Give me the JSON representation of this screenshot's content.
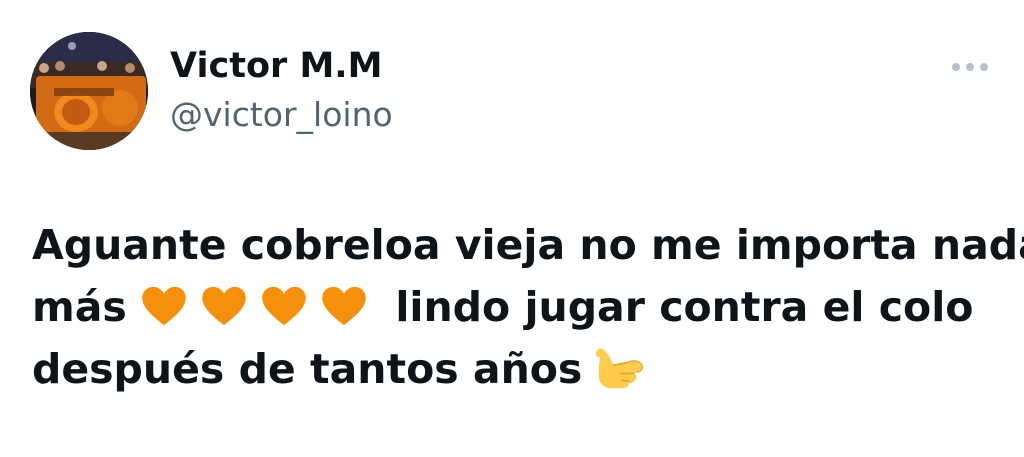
{
  "author": {
    "display_name": "Victor M.M",
    "handle": "@victor_loino",
    "avatar_icon": "avatar-photo"
  },
  "toolbar": {
    "more_icon": "more-horizontal-icon"
  },
  "tweet": {
    "line1": "Aguante cobreloa vieja no me importa nada",
    "line2_before": "más",
    "line2_after": "lindo jugar contra el colo",
    "line3": "después de tantos años",
    "emojis": [
      "orange-heart",
      "orange-heart",
      "orange-heart",
      "orange-heart",
      "call-me-hand"
    ]
  },
  "colors": {
    "text": "#0f1419",
    "handle": "#536471",
    "heart": "#f4900c",
    "hand": "#ffcc4d",
    "dots": "#b7c0c8"
  }
}
